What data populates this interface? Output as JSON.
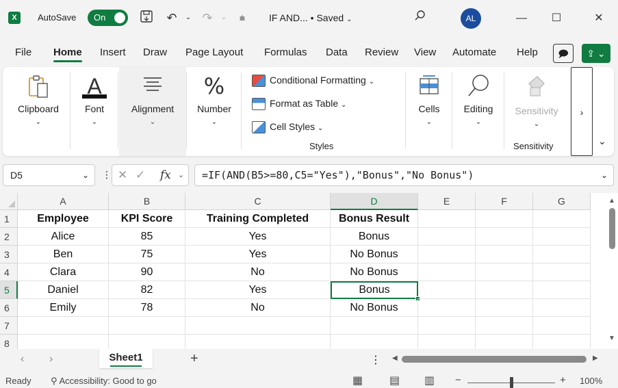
{
  "titlebar": {
    "app_logo": "X",
    "autosave_label": "AutoSave",
    "autosave_state": "On",
    "doc_title": "IF AND... • Saved",
    "user_initials": "AL"
  },
  "menu": {
    "tabs": [
      "File",
      "Home",
      "Insert",
      "Draw",
      "Page Layout",
      "Formulas",
      "Data",
      "Review",
      "View",
      "Automate",
      "Help"
    ],
    "active_tab": "Home"
  },
  "ribbon": {
    "clipboard": "Clipboard",
    "font": "Font",
    "alignment": "Alignment",
    "number": "Number",
    "conditional_formatting": "Conditional Formatting",
    "format_as_table": "Format as Table",
    "cell_styles": "Cell Styles",
    "styles_group": "Styles",
    "cells": "Cells",
    "editing": "Editing",
    "sensitivity_btn": "Sensitivity",
    "sensitivity_group": "Sensitivity"
  },
  "formula_bar": {
    "name_box": "D5",
    "formula": "=IF(AND(B5>=80,C5=\"Yes\"),\"Bonus\",\"No Bonus\")"
  },
  "sheet": {
    "columns": [
      "A",
      "B",
      "C",
      "D",
      "E",
      "F",
      "G"
    ],
    "selected_column": "D",
    "selected_row": 5,
    "rows": [
      {
        "num": "1",
        "cells": [
          "Employee",
          "KPI Score",
          "Training Completed",
          "Bonus Result",
          "",
          "",
          ""
        ]
      },
      {
        "num": "2",
        "cells": [
          "Alice",
          "85",
          "Yes",
          "Bonus",
          "",
          "",
          ""
        ]
      },
      {
        "num": "3",
        "cells": [
          "Ben",
          "75",
          "Yes",
          "No Bonus",
          "",
          "",
          ""
        ]
      },
      {
        "num": "4",
        "cells": [
          "Clara",
          "90",
          "No",
          "No Bonus",
          "",
          "",
          ""
        ]
      },
      {
        "num": "5",
        "cells": [
          "Daniel",
          "82",
          "Yes",
          "Bonus",
          "",
          "",
          ""
        ]
      },
      {
        "num": "6",
        "cells": [
          "Emily",
          "78",
          "No",
          "No Bonus",
          "",
          "",
          ""
        ]
      },
      {
        "num": "7",
        "cells": [
          "",
          "",
          "",
          "",
          "",
          "",
          ""
        ]
      },
      {
        "num": "8",
        "cells": [
          "",
          "",
          "",
          "",
          "",
          "",
          ""
        ]
      }
    ]
  },
  "sheet_tabs": {
    "active": "Sheet1"
  },
  "statusbar": {
    "ready": "Ready",
    "accessibility": "Accessibility: Good to go",
    "zoom": "100%"
  },
  "colors": {
    "accent": "#107c41",
    "avatar": "#1b4d9e"
  }
}
